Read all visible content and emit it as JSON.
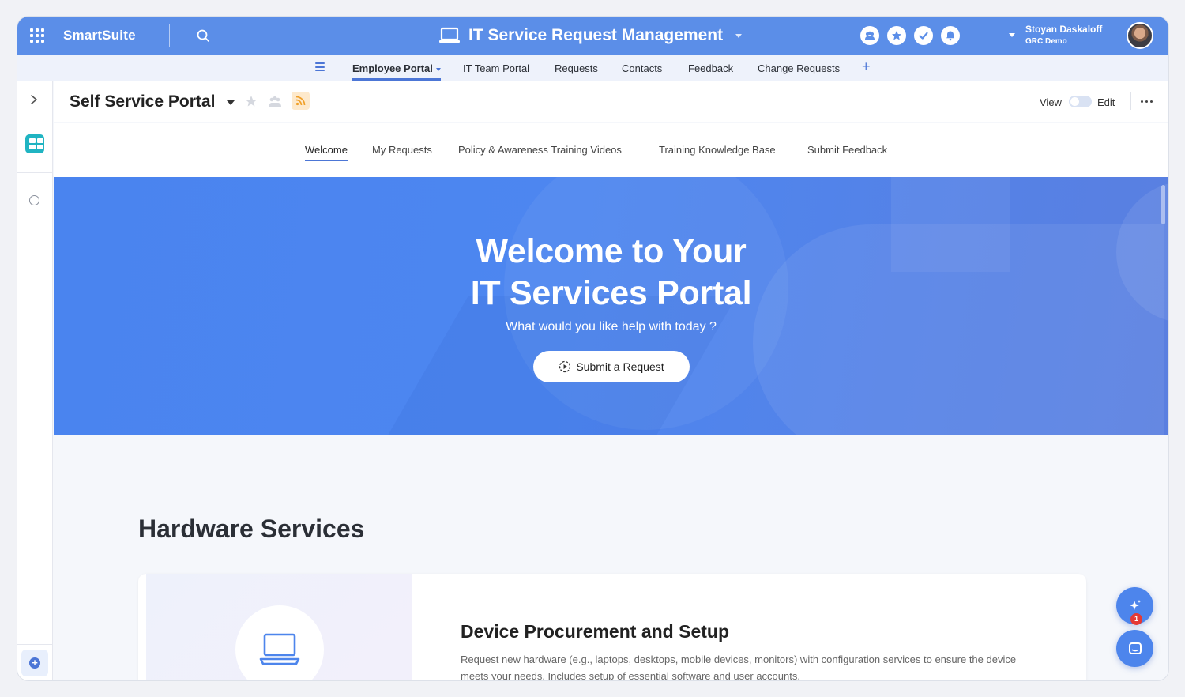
{
  "app": {
    "brand": "SmartSuite",
    "solution_title": "IT Service Request Management"
  },
  "user": {
    "name": "Stoyan Daskaloff",
    "workspace": "GRC Demo"
  },
  "app_tabs": [
    {
      "label": "Employee Portal",
      "active": true
    },
    {
      "label": "IT Team Portal"
    },
    {
      "label": "Requests"
    },
    {
      "label": "Contacts"
    },
    {
      "label": "Feedback"
    },
    {
      "label": "Change Requests"
    }
  ],
  "page": {
    "title": "Self Service Portal",
    "view_label": "View",
    "edit_label": "Edit"
  },
  "page_tabs": [
    {
      "label": "Welcome",
      "active": true
    },
    {
      "label": "My Requests"
    },
    {
      "label": "Policy & Awareness Training Videos"
    },
    {
      "label": "Training Knowledge Base"
    },
    {
      "label": "Submit Feedback"
    }
  ],
  "hero": {
    "title_line1": "Welcome to Your",
    "title_line2": "IT Services Portal",
    "subtitle": "What would you like help with today ?",
    "cta_label": "Submit a Request"
  },
  "section": {
    "title": "Hardware Services",
    "card_title": "Device Procurement and Setup",
    "card_desc_line1": "Request new hardware (e.g., laptops, desktops, mobile devices, monitors) with configuration services to ensure the device",
    "card_desc_line2": "meets your needs. Includes setup of essential software and user accounts."
  },
  "chat": {
    "unread": "1"
  },
  "colors": {
    "topbar": "#5b8ee8",
    "accent": "#4c76d6",
    "hero": "#4a84ef"
  }
}
